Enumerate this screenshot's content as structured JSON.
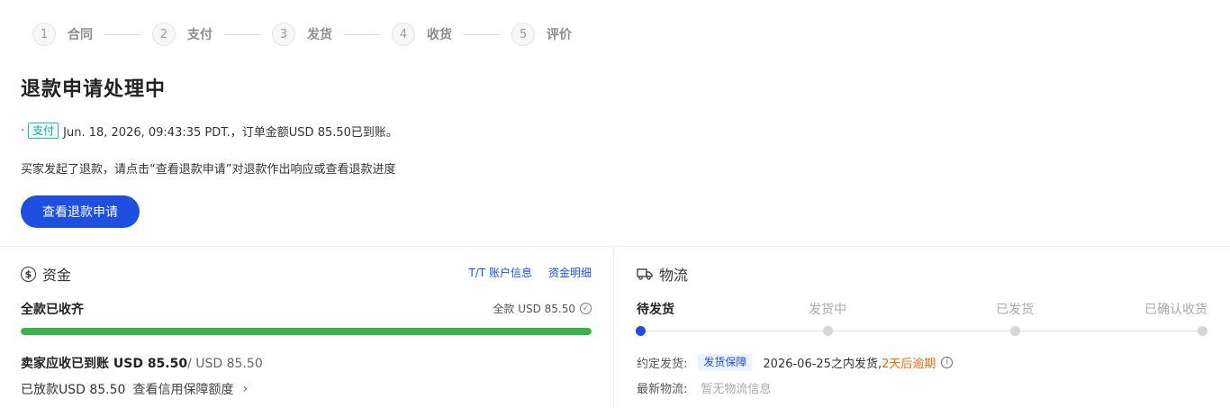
{
  "steps": [
    {
      "num": "1",
      "label": "合同"
    },
    {
      "num": "2",
      "label": "支付"
    },
    {
      "num": "3",
      "label": "发货"
    },
    {
      "num": "4",
      "label": "收货"
    },
    {
      "num": "5",
      "label": "评价"
    }
  ],
  "status": {
    "title": "退款申请处理中",
    "pay_tag": "支付",
    "pay_info": "Jun. 18, 2026, 09:43:35 PDT.，订单金额USD 85.50已到账。",
    "refund_notice": "买家发起了退款，请点击“查看退款申请”对退款作出响应或查看退款进度",
    "refund_button": "查看退款申请"
  },
  "funds": {
    "title": "资金",
    "icon": "dollar-circle-icon",
    "links": [
      "T/T 账户信息",
      "资金明细"
    ],
    "status": "全款已收齐",
    "full_amount": "全款  USD 85.50",
    "progress_percent": 100,
    "progress_color": "#3cb34a",
    "seller_due_label": "卖家应收已到账 USD 85.50",
    "seller_due_total": "/ USD 85.50",
    "released": "已放款USD 85.50",
    "credit_link": "查看信用保障额度"
  },
  "logistics": {
    "title": "物流",
    "icon": "truck-icon",
    "stages": [
      "待发货",
      "发货中",
      "已发货",
      "已确认收货"
    ],
    "current_stage": 0,
    "ship_label": "约定发货:",
    "guarantee_tag": "发货保障",
    "ship_date": "2026-06-25之内发货, ",
    "overdue": "2天后逾期",
    "latest_label": "最新物流:",
    "latest_value": "暂无物流信息"
  },
  "colors": {
    "primary": "#1f4fe0",
    "success": "#3cb34a",
    "warning": "#e06a17",
    "pay_tag": "#1aa38f"
  }
}
